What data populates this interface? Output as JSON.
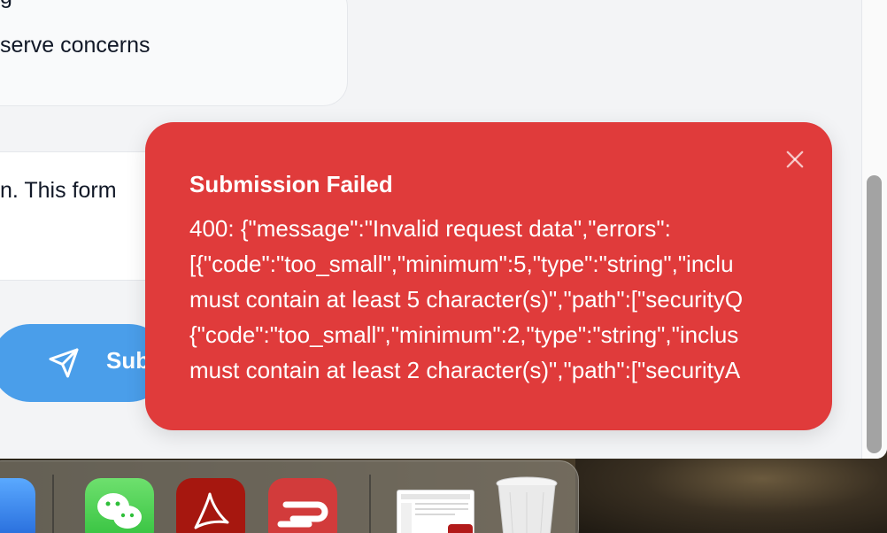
{
  "background_card": {
    "line1": "g",
    "line2": "serve concerns"
  },
  "textarea": {
    "visible_text": "n. This form"
  },
  "submit_button": {
    "label": "Sub",
    "icon": "send-icon",
    "color": "#4a9eea"
  },
  "toast": {
    "title": "Submission Failed",
    "lines": [
      "400: {\"message\":\"Invalid request data\",\"errors\":",
      "[{\"code\":\"too_small\",\"minimum\":5,\"type\":\"string\",\"inclu",
      "must contain at least 5 character(s)\",\"path\":[\"securityQ",
      "{\"code\":\"too_small\",\"minimum\":2,\"type\":\"string\",\"inclus",
      "must contain at least 2 character(s)\",\"path\":[\"securityA"
    ],
    "close_icon": "close-icon",
    "color": "#e03b3b"
  },
  "dock": {
    "apps": [
      {
        "name": "app-icon-blue",
        "icon": "app-icon"
      },
      {
        "name": "wechat",
        "icon": "wechat-icon"
      },
      {
        "name": "acrobat",
        "icon": "acrobat-icon"
      },
      {
        "name": "expressvpn",
        "icon": "expressvpn-icon"
      },
      {
        "name": "preview-document",
        "icon": "document-thumbnail-icon"
      },
      {
        "name": "trash",
        "icon": "trash-icon"
      }
    ]
  }
}
